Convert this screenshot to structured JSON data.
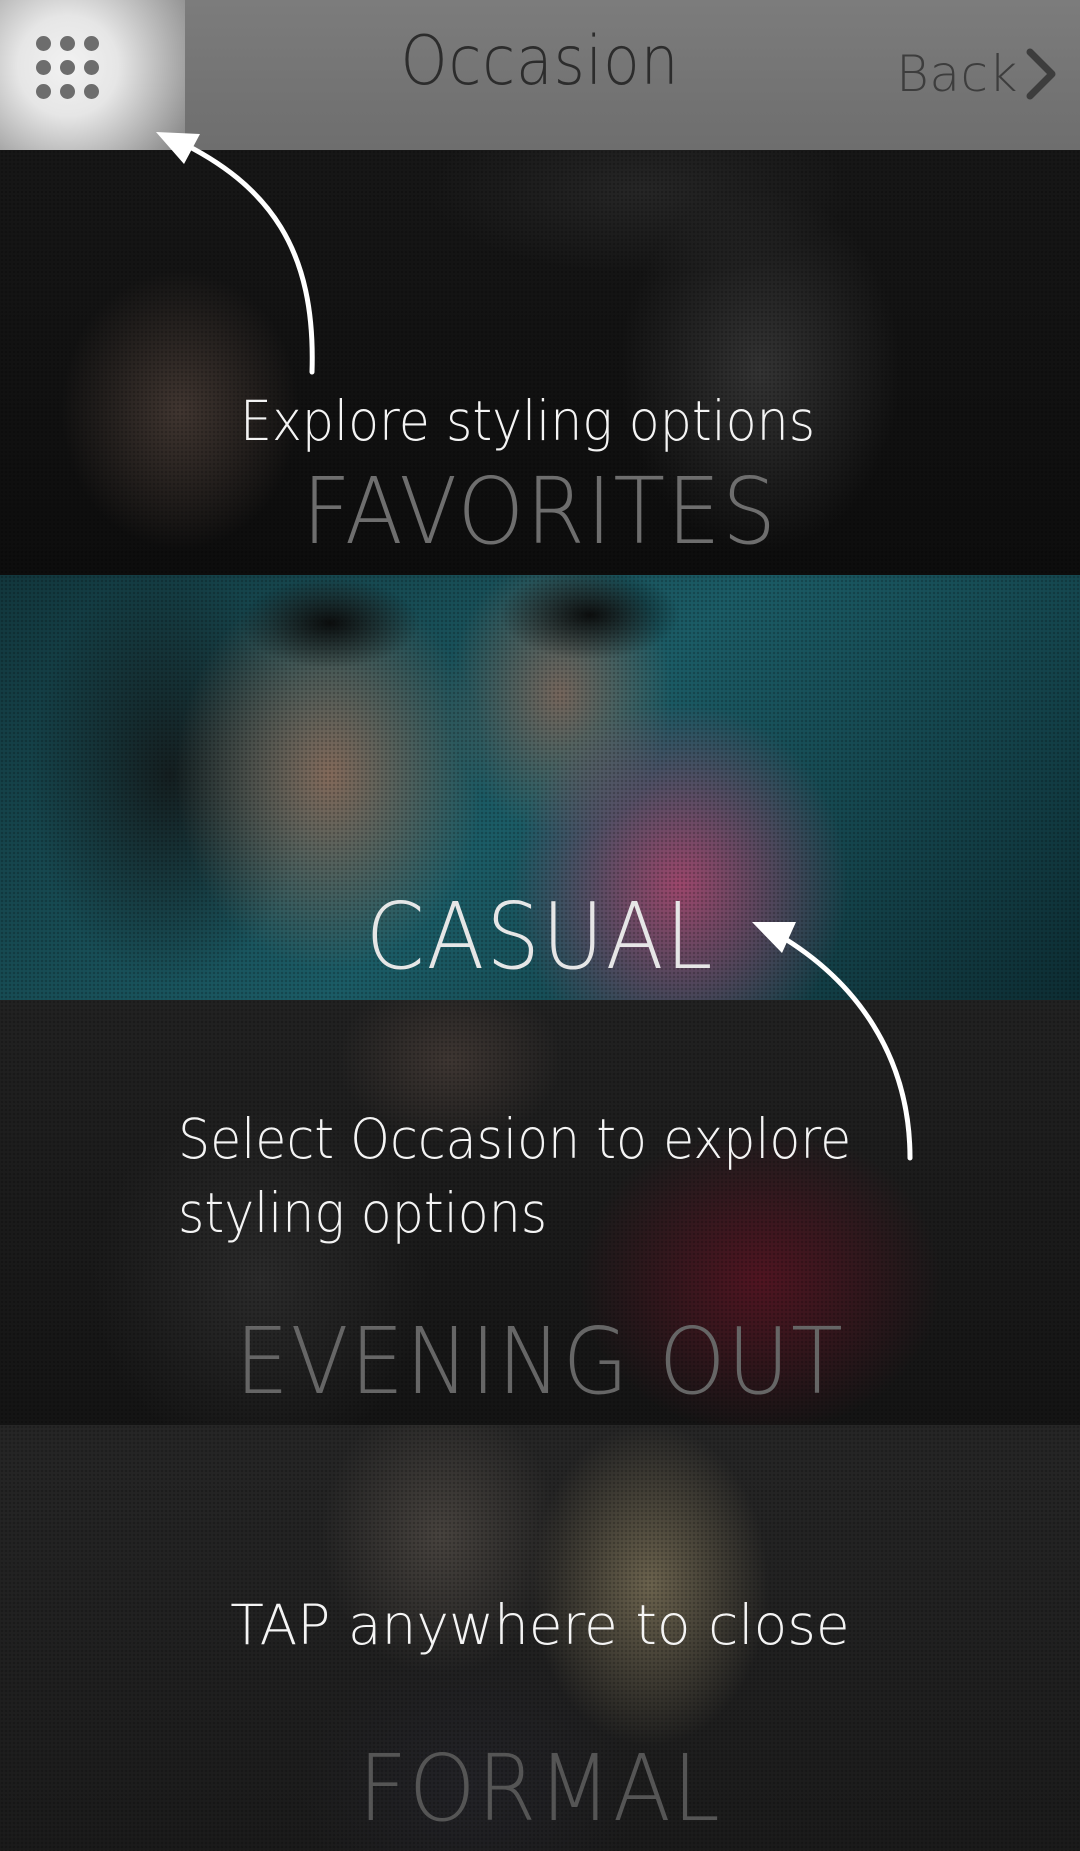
{
  "header": {
    "title": "Occasion",
    "back_label": "Back"
  },
  "occasions": [
    {
      "label": "FAVORITES"
    },
    {
      "label": "CASUAL"
    },
    {
      "label": "EVENING OUT"
    },
    {
      "label": "FORMAL"
    }
  ],
  "overlay": {
    "explore_hint": "Explore styling options",
    "select_hint_line1": "Select Occasion to explore",
    "select_hint_line2": "styling options",
    "close_hint": "TAP anywhere to close"
  },
  "icons": {
    "menu": "grid-menu-icon",
    "back": "chevron-right-icon"
  },
  "colors": {
    "header_bg": "#7c7c7c",
    "casual_bg": "#1b5c66",
    "hint_text": "#f4f4f4"
  }
}
